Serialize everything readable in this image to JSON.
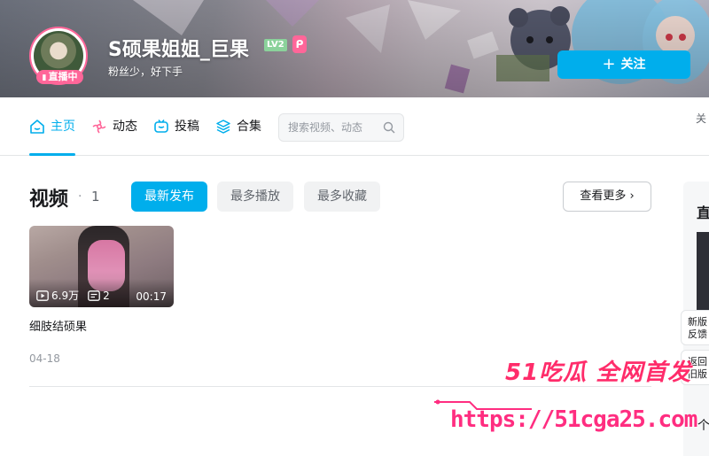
{
  "header": {
    "username": "S硕果姐姐_巨果",
    "level": "LV2",
    "live_badge": "直播中",
    "signature": "粉丝少，好下手",
    "follow_label": "关注"
  },
  "nav": {
    "tabs": [
      {
        "label": "主页",
        "icon": "home-icon"
      },
      {
        "label": "动态",
        "icon": "dynamic-icon"
      },
      {
        "label": "投稿",
        "icon": "upload-tv-icon"
      },
      {
        "label": "合集",
        "icon": "collection-icon"
      }
    ],
    "search_placeholder": "搜索视频、动态",
    "right_text": "关"
  },
  "videos": {
    "title": "视频",
    "dot": "·",
    "count": "1",
    "sort_options": [
      "最新发布",
      "最多播放",
      "最多收藏"
    ],
    "more_label": "查看更多",
    "items": [
      {
        "play_count": "6.9万",
        "danmaku_count": "2",
        "duration": "00:17",
        "title": "细肢结硕果",
        "date": "04-18"
      }
    ]
  },
  "side": {
    "title": "直",
    "float_new": "新版反馈",
    "float_new_l1": "新版",
    "float_new_l2": "反馈",
    "float_old_l1": "返回",
    "float_old_l2": "旧版",
    "bottom": "个"
  },
  "watermark": {
    "top": "51吃瓜 全网首发",
    "url": "https://51cga25.com"
  },
  "colors": {
    "accent": "#00aeec",
    "pink": "#ff6699",
    "watermark": "#ff2d80"
  }
}
